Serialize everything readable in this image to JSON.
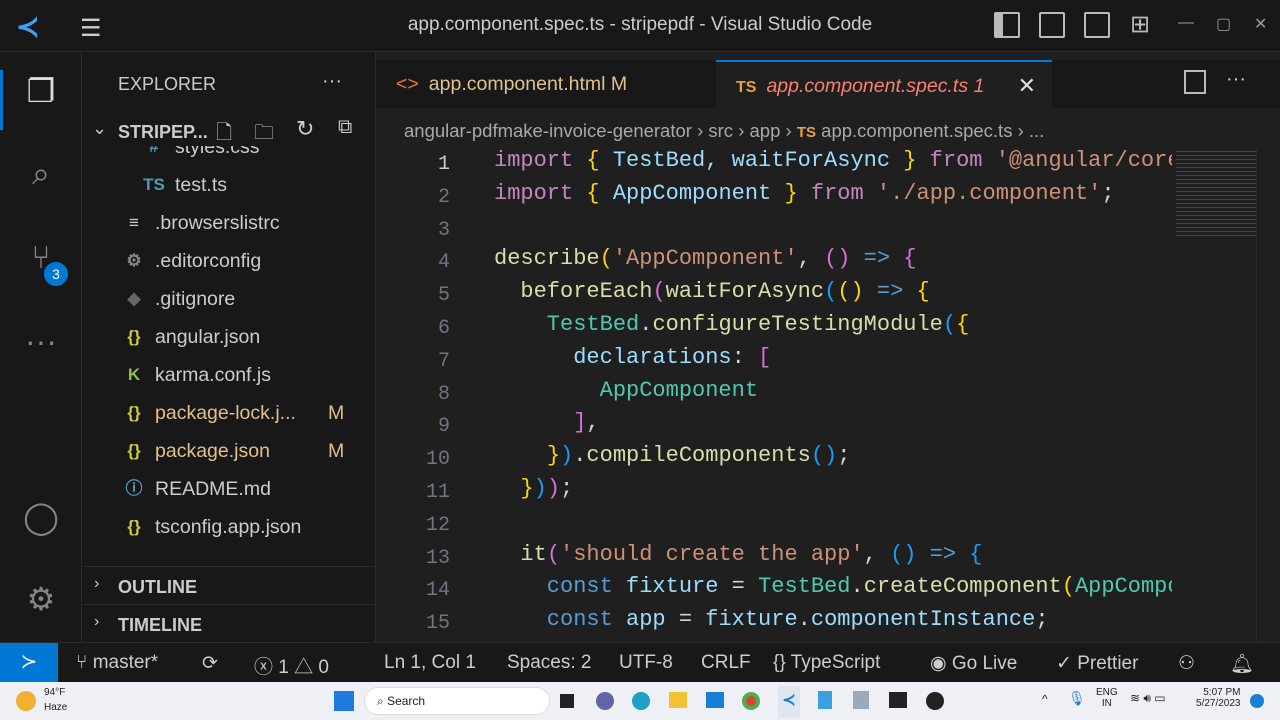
{
  "window": {
    "title": "app.component.spec.ts - stripepdf - Visual Studio Code"
  },
  "activity": {
    "scm_badge": "3"
  },
  "explorer": {
    "title": "EXPLORER",
    "more": "···",
    "folder": "STRIPEP...",
    "files": [
      {
        "icon": "#",
        "name": "styles.css",
        "color": "#519aba",
        "indent": 1
      },
      {
        "icon": "TS",
        "name": "test.ts",
        "color": "#519aba",
        "indent": 1
      },
      {
        "icon": "≡",
        "name": ".browserslistrc",
        "color": "#ccc",
        "indent": 0
      },
      {
        "icon": "⚙",
        "name": ".editorconfig",
        "color": "#888",
        "indent": 0
      },
      {
        "icon": "◆",
        "name": ".gitignore",
        "color": "#666",
        "indent": 0
      },
      {
        "icon": "{}",
        "name": "angular.json",
        "color": "#cbcb41",
        "indent": 0
      },
      {
        "icon": "K",
        "name": "karma.conf.js",
        "color": "#8dc149",
        "indent": 0
      },
      {
        "icon": "{}",
        "name": "package-lock.j...",
        "color": "#cbcb41",
        "indent": 0,
        "badge": "M"
      },
      {
        "icon": "{}",
        "name": "package.json",
        "color": "#cbcb41",
        "indent": 0,
        "badge": "M"
      },
      {
        "icon": "ⓘ",
        "name": "README.md",
        "color": "#519aba",
        "indent": 0
      },
      {
        "icon": "{}",
        "name": "tsconfig.app.json",
        "color": "#cbcb41",
        "indent": 0
      }
    ],
    "outline": "OUTLINE",
    "timeline": "TIMELINE"
  },
  "tabs": [
    {
      "icon": "<>",
      "label": "app.component.html",
      "badge": "M"
    },
    {
      "icon": "TS",
      "label": "app.component.spec.ts",
      "badge": "1",
      "close": "✕"
    }
  ],
  "breadcrumb": [
    "angular-pdfmake-invoice-generator",
    "src",
    "app",
    "app.component.spec.ts",
    "..."
  ],
  "breadcrumb_ts": "TS",
  "code": [
    [
      [
        "import",
        "k"
      ],
      [
        " ",
        "d"
      ],
      [
        "{",
        "y"
      ],
      [
        " TestBed, waitForAsync ",
        "v"
      ],
      [
        "}",
        "y"
      ],
      [
        " from ",
        "k"
      ],
      [
        "'@angular/core/testing'",
        "s"
      ],
      [
        ";",
        "d"
      ]
    ],
    [
      [
        "import",
        "k"
      ],
      [
        " ",
        "d"
      ],
      [
        "{",
        "y"
      ],
      [
        " AppComponent ",
        "v"
      ],
      [
        "}",
        "y"
      ],
      [
        " from ",
        "k"
      ],
      [
        "'./app.component'",
        "s"
      ],
      [
        ";",
        "d"
      ]
    ],
    [],
    [
      [
        "describe",
        "f"
      ],
      [
        "(",
        "y"
      ],
      [
        "'AppComponent'",
        "s"
      ],
      [
        ", ",
        "d"
      ],
      [
        "()",
        "p"
      ],
      [
        " => ",
        "t"
      ],
      [
        "{",
        "p"
      ]
    ],
    [
      [
        "  beforeEach",
        "f"
      ],
      [
        "(",
        "p"
      ],
      [
        "waitForAsync",
        "f"
      ],
      [
        "(",
        "b"
      ],
      [
        "()",
        "y"
      ],
      [
        " => ",
        "t"
      ],
      [
        "{",
        "y"
      ]
    ],
    [
      [
        "    TestBed",
        "c"
      ],
      [
        ".",
        "d"
      ],
      [
        "configureTestingModule",
        "f"
      ],
      [
        "(",
        "b"
      ],
      [
        "{",
        "y"
      ]
    ],
    [
      [
        "      declarations",
        "v"
      ],
      [
        ": ",
        "d"
      ],
      [
        "[",
        "p"
      ]
    ],
    [
      [
        "        AppComponent",
        "c"
      ]
    ],
    [
      [
        "      ",
        "d"
      ],
      [
        "]",
        "p"
      ],
      [
        ",",
        "d"
      ]
    ],
    [
      [
        "    ",
        "d"
      ],
      [
        "}",
        "y"
      ],
      [
        ")",
        "b"
      ],
      [
        ".",
        "d"
      ],
      [
        "compileComponents",
        "f"
      ],
      [
        "()",
        "b"
      ],
      [
        ";",
        "d"
      ]
    ],
    [
      [
        "  ",
        "d"
      ],
      [
        "}",
        "y"
      ],
      [
        ")",
        "b"
      ],
      [
        ")",
        "p"
      ],
      [
        ";",
        "d"
      ]
    ],
    [],
    [
      [
        "  it",
        "f"
      ],
      [
        "(",
        "p"
      ],
      [
        "'should create the app'",
        "s"
      ],
      [
        ", ",
        "d"
      ],
      [
        "()",
        "b"
      ],
      [
        " => ",
        "t"
      ],
      [
        "{",
        "b"
      ]
    ],
    [
      [
        "    const",
        "t"
      ],
      [
        " fixture ",
        "v"
      ],
      [
        "= ",
        "d"
      ],
      [
        "TestBed",
        "c"
      ],
      [
        ".",
        "d"
      ],
      [
        "createComponent",
        "f"
      ],
      [
        "(",
        "y"
      ],
      [
        "AppComponent",
        "c"
      ],
      [
        ")",
        "y"
      ],
      [
        ";",
        "d"
      ]
    ],
    [
      [
        "    const",
        "t"
      ],
      [
        " app ",
        "v"
      ],
      [
        "= ",
        "d"
      ],
      [
        "fixture",
        "v"
      ],
      [
        ".",
        "d"
      ],
      [
        "componentInstance",
        "v"
      ],
      [
        ";",
        "d"
      ]
    ]
  ],
  "status": {
    "branch": "master*",
    "errors": "1",
    "warnings": "0",
    "position": "Ln 1, Col 1",
    "spaces": "Spaces: 2",
    "encoding": "UTF-8",
    "eol": "CRLF",
    "language": "TypeScript",
    "golive": "Go Live",
    "prettier": "Prettier"
  },
  "taskbar": {
    "temp": "94°F",
    "weather": "Haze",
    "search": "Search",
    "lang1": "ENG",
    "lang2": "IN",
    "time": "5:07 PM",
    "date": "5/27/2023"
  }
}
